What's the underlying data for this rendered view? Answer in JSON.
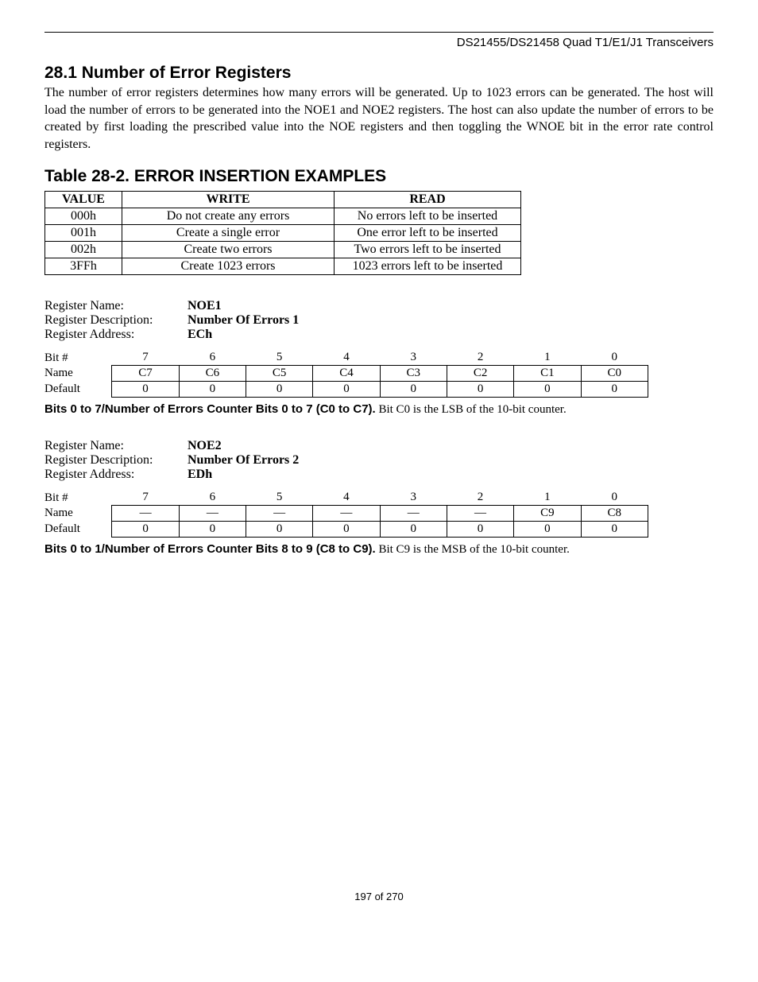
{
  "header": "DS21455/DS21458 Quad T1/E1/J1 Transceivers",
  "section_title": "28.1  Number of Error Registers",
  "section_body": "The number of error registers determines how many errors will be generated. Up to 1023 errors can be generated. The host will load the number of errors to be generated into the NOE1 and NOE2 registers. The host can also update the number of errors to be created by first loading the prescribed value into the NOE registers and then toggling the WNOE bit in the error rate control registers.",
  "table_title": "Table 28-2. ERROR INSERTION EXAMPLES",
  "error_table": {
    "headers": [
      "VALUE",
      "WRITE",
      "READ"
    ],
    "rows": [
      [
        "000h",
        "Do not create any errors",
        "No errors left to be inserted"
      ],
      [
        "001h",
        "Create a single error",
        "One error left to be inserted"
      ],
      [
        "002h",
        "Create two errors",
        "Two errors left to be inserted"
      ],
      [
        "3FFh",
        "Create 1023 errors",
        "1023 errors left to be inserted"
      ]
    ]
  },
  "reg1": {
    "labels": {
      "name": "Register Name:",
      "desc": "Register Description:",
      "addr": "Register Address:"
    },
    "values": {
      "name": "NOE1",
      "desc": "Number Of Errors 1",
      "addr": "ECh"
    },
    "bit_header_label": "Bit #",
    "name_label": "Name",
    "default_label": "Default",
    "bits": [
      "7",
      "6",
      "5",
      "4",
      "3",
      "2",
      "1",
      "0"
    ],
    "names": [
      "C7",
      "C6",
      "C5",
      "C4",
      "C3",
      "C2",
      "C1",
      "C0"
    ],
    "defaults": [
      "0",
      "0",
      "0",
      "0",
      "0",
      "0",
      "0",
      "0"
    ],
    "desc_lead": "Bits 0 to 7/Number of Errors Counter Bits 0 to 7 (C0 to C7).",
    "desc_rest": " Bit C0 is the LSB of the 10-bit counter."
  },
  "reg2": {
    "labels": {
      "name": "Register Name:",
      "desc": "Register Description:",
      "addr": "Register Address:"
    },
    "values": {
      "name": "NOE2",
      "desc": "Number Of Errors 2",
      "addr": "EDh"
    },
    "bit_header_label": "Bit #",
    "name_label": "Name",
    "default_label": "Default",
    "bits": [
      "7",
      "6",
      "5",
      "4",
      "3",
      "2",
      "1",
      "0"
    ],
    "names": [
      "—",
      "—",
      "—",
      "—",
      "—",
      "—",
      "C9",
      "C8"
    ],
    "defaults": [
      "0",
      "0",
      "0",
      "0",
      "0",
      "0",
      "0",
      "0"
    ],
    "desc_lead": "Bits 0 to 1/Number of Errors Counter Bits 8 to 9 (C8 to C9).",
    "desc_rest": " Bit C9 is the MSB of the 10-bit counter."
  },
  "footer": "197 of 270"
}
